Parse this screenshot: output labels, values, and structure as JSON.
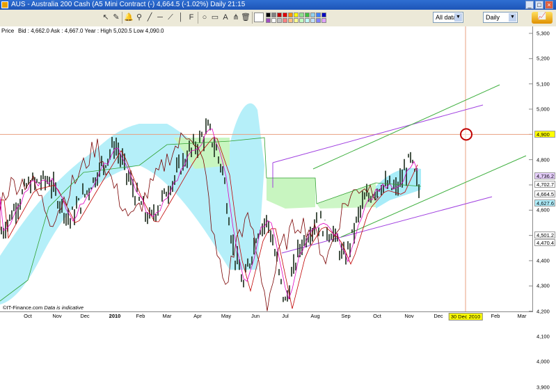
{
  "window": {
    "title": "AUS - Australia 200 Cash (A5 Mini Contract (-)    4,664.5 (-1.02%)   Daily  21:15"
  },
  "toolbar": {
    "data_range": "All data",
    "interval": "Daily",
    "colors": [
      "#000000",
      "#808080",
      "#c00000",
      "#e00000",
      "#ff9000",
      "#ffff00",
      "#90e090",
      "#40c040",
      "#90d0f0",
      "#4080ff",
      "#0000c0",
      "#a050c0",
      "#ffffff",
      "#c0c0c0",
      "#ff8080",
      "#ffc080",
      "#ffff90",
      "#c0ffc0",
      "#c0ffff",
      "#c0e0ff",
      "#8080ff",
      "#e0a0ff"
    ]
  },
  "chart": {
    "panel_label": "Price",
    "info": "Bid : 4,662.0  Ask : 4,667.0  Year : High 5,020.5 Low 4,090.0",
    "credit_brand": "IT-Finance.com",
    "credit_note": "Data is indicative",
    "y_labels": [
      "5,300",
      "5,200",
      "5,100",
      "5,000",
      "4,900",
      "4,800",
      "4,700",
      "4,600",
      "4,500",
      "4,400",
      "4,300",
      "4,200",
      "4,100",
      "4,000",
      "3,900"
    ],
    "x_labels": [
      "Oct",
      "Nov",
      "Dec",
      "2010",
      "Feb",
      "Mar",
      "Apr",
      "May",
      "Jun",
      "Jul",
      "Aug",
      "Sep",
      "Oct",
      "Nov",
      "Dec",
      "Feb",
      "Mar"
    ],
    "crosshair_date": "30 Dec 2010",
    "crosshair_price": "4,900",
    "price_tags": [
      {
        "label": "4,736.2",
        "color": "#e8d0ff"
      },
      {
        "label": "4,702.7",
        "color": "#ffffff"
      },
      {
        "label": "4,664.5",
        "color": "#ffffff"
      },
      {
        "label": "4,627.6",
        "color": "#b0f0ff"
      },
      {
        "label": "4,501.2",
        "color": "#ffffff"
      },
      {
        "label": "4,470.4",
        "color": "#ffffff"
      }
    ],
    "colors": {
      "crosshair": "#e8a080",
      "channel_purple": "#a040e0",
      "channel_green": "#40b040",
      "cloud_cyan": "#a8ecf8",
      "cloud_green": "#c8f5c0",
      "lagging": "#7a0000",
      "kijun": "#c00000",
      "tenkan": "#e000c0"
    }
  }
}
